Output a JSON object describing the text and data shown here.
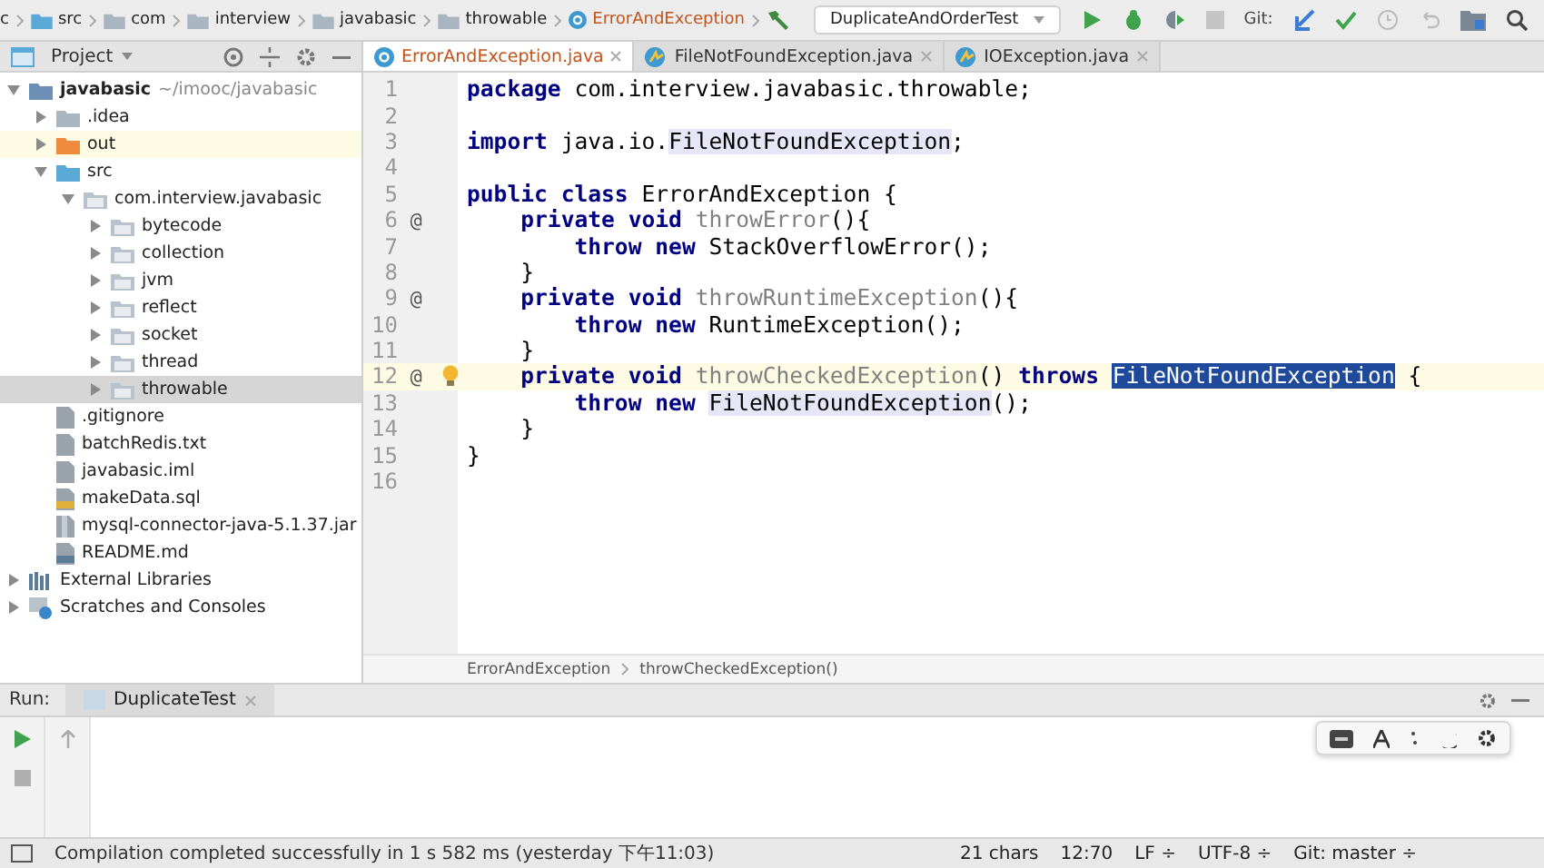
{
  "nav_bar": {
    "breadcrumbs": [
      {
        "label": "c",
        "kind": "plain"
      },
      {
        "label": "src",
        "kind": "source"
      },
      {
        "label": "com",
        "kind": "folder"
      },
      {
        "label": "interview",
        "kind": "folder"
      },
      {
        "label": "javabasic",
        "kind": "folder"
      },
      {
        "label": "throwable",
        "kind": "folder"
      },
      {
        "label": "ErrorAndException",
        "kind": "class"
      }
    ],
    "run_config": "DuplicateAndOrderTest",
    "git_label": "Git:"
  },
  "project_panel": {
    "title": "Project",
    "tree": [
      {
        "label": "javabasic",
        "path": "~/imooc/javabasic",
        "kind": "module",
        "expanded": true,
        "selected": false,
        "children": [
          {
            "label": ".idea",
            "kind": "folder",
            "expanded": false,
            "selected": false
          },
          {
            "label": "out",
            "kind": "excluded",
            "expanded": false,
            "selected": false
          },
          {
            "label": "src",
            "kind": "source",
            "expanded": true,
            "selected": false,
            "children": [
              {
                "label": "com.interview.javabasic",
                "kind": "package",
                "expanded": true,
                "selected": false,
                "children": [
                  {
                    "label": "bytecode",
                    "kind": "package",
                    "expanded": false,
                    "selected": false
                  },
                  {
                    "label": "collection",
                    "kind": "package",
                    "expanded": false,
                    "selected": false
                  },
                  {
                    "label": "jvm",
                    "kind": "package",
                    "expanded": false,
                    "selected": false
                  },
                  {
                    "label": "reflect",
                    "kind": "package",
                    "expanded": false,
                    "selected": false
                  },
                  {
                    "label": "socket",
                    "kind": "package",
                    "expanded": false,
                    "selected": false
                  },
                  {
                    "label": "thread",
                    "kind": "package",
                    "expanded": false,
                    "selected": false
                  },
                  {
                    "label": "throwable",
                    "kind": "package",
                    "expanded": false,
                    "selected": true
                  }
                ]
              }
            ]
          },
          {
            "label": ".gitignore",
            "kind": "file",
            "selected": false
          },
          {
            "label": "batchRedis.txt",
            "kind": "file",
            "selected": false
          },
          {
            "label": "javabasic.iml",
            "kind": "file",
            "selected": false
          },
          {
            "label": "makeData.sql",
            "kind": "sql",
            "selected": false
          },
          {
            "label": "mysql-connector-java-5.1.37.jar",
            "kind": "jar",
            "selected": false
          },
          {
            "label": "README.md",
            "kind": "md",
            "selected": false
          }
        ]
      },
      {
        "label": "External Libraries",
        "kind": "libraries",
        "expanded": false,
        "selected": false
      },
      {
        "label": "Scratches and Consoles",
        "kind": "scratches",
        "expanded": false,
        "selected": false
      }
    ]
  },
  "editor_tabs": [
    {
      "label": "ErrorAndException.java",
      "kind": "class",
      "selected": true
    },
    {
      "label": "FileNotFoundException.java",
      "kind": "exception",
      "selected": false
    },
    {
      "label": "IOException.java",
      "kind": "exception",
      "selected": false
    }
  ],
  "code": {
    "lines": [
      {
        "number": "1",
        "current": false,
        "tokens": [
          {
            "kind": "kw",
            "text": "package"
          },
          {
            "kind": "plain",
            "text": " com.interview.javabasic.throwable;"
          }
        ]
      },
      {
        "number": "2",
        "current": false
      },
      {
        "number": "3",
        "current": false,
        "tokens": [
          {
            "kind": "kw",
            "text": "import"
          },
          {
            "kind": "plain",
            "text": " java.io."
          },
          {
            "kind": "usage",
            "text": "FileNotFoundException"
          },
          {
            "kind": "plain",
            "text": ";"
          }
        ]
      },
      {
        "number": "4",
        "current": false
      },
      {
        "number": "5",
        "current": false,
        "tokens": [
          {
            "kind": "kw",
            "text": "public class"
          },
          {
            "kind": "plain",
            "text": " ErrorAndException {"
          }
        ]
      },
      {
        "number": "6",
        "current": false,
        "marker": "@",
        "tokens": [
          {
            "kind": "kw",
            "text": "private void "
          },
          {
            "kind": "unused",
            "text": "throwError"
          },
          {
            "kind": "plain",
            "text": "(){"
          }
        ]
      },
      {
        "number": "7",
        "current": false,
        "tokens": [
          {
            "kind": "kw",
            "text": "throw new"
          },
          {
            "kind": "plain",
            "text": " StackOverflowError();"
          }
        ]
      },
      {
        "number": "8",
        "current": false,
        "tokens": [
          {
            "kind": "plain",
            "text": "}"
          }
        ]
      },
      {
        "number": "9",
        "current": false,
        "marker": "@",
        "tokens": [
          {
            "kind": "kw",
            "text": "private void "
          },
          {
            "kind": "unused",
            "text": "throwRuntimeException"
          },
          {
            "kind": "plain",
            "text": "(){"
          }
        ]
      },
      {
        "number": "10",
        "current": false,
        "tokens": [
          {
            "kind": "kw",
            "text": "throw new"
          },
          {
            "kind": "plain",
            "text": " RuntimeException();"
          }
        ]
      },
      {
        "number": "11",
        "current": false,
        "tokens": [
          {
            "kind": "plain",
            "text": "}"
          }
        ]
      },
      {
        "number": "12",
        "current": true,
        "marker": "@",
        "bulb": true,
        "tokens": [
          {
            "kind": "kw",
            "text": "private void "
          },
          {
            "kind": "unused",
            "text": "throwCheckedException"
          },
          {
            "kind": "plain",
            "text": "() "
          },
          {
            "kind": "kw",
            "text": "throws "
          },
          {
            "kind": "selection",
            "text": "FileNotFoundException"
          },
          {
            "kind": "plain",
            "text": " {"
          }
        ]
      },
      {
        "number": "13",
        "current": false,
        "tokens": [
          {
            "kind": "kw",
            "text": "throw new "
          },
          {
            "kind": "usage",
            "text": "FileNotFoundException"
          },
          {
            "kind": "plain",
            "text": "();"
          }
        ]
      },
      {
        "number": "14",
        "current": false,
        "tokens": [
          {
            "kind": "plain",
            "text": "}"
          }
        ]
      },
      {
        "number": "15",
        "current": false,
        "tokens": [
          {
            "kind": "plain",
            "text": "}"
          }
        ]
      },
      {
        "number": "16",
        "current": false
      }
    ]
  },
  "editor_breadcrumbs": [
    "ErrorAndException",
    "throwCheckedException()"
  ],
  "run_panel": {
    "label": "Run:",
    "tab": "DuplicateTest"
  },
  "status_bar": {
    "message": "Compilation completed successfully in 1 s 582 ms (yesterday 下午11:03)",
    "chars": "21 chars",
    "position": "12:70",
    "line_ending": "LF ÷",
    "encoding": "UTF-8 ÷",
    "vcs": "Git: master ÷"
  }
}
